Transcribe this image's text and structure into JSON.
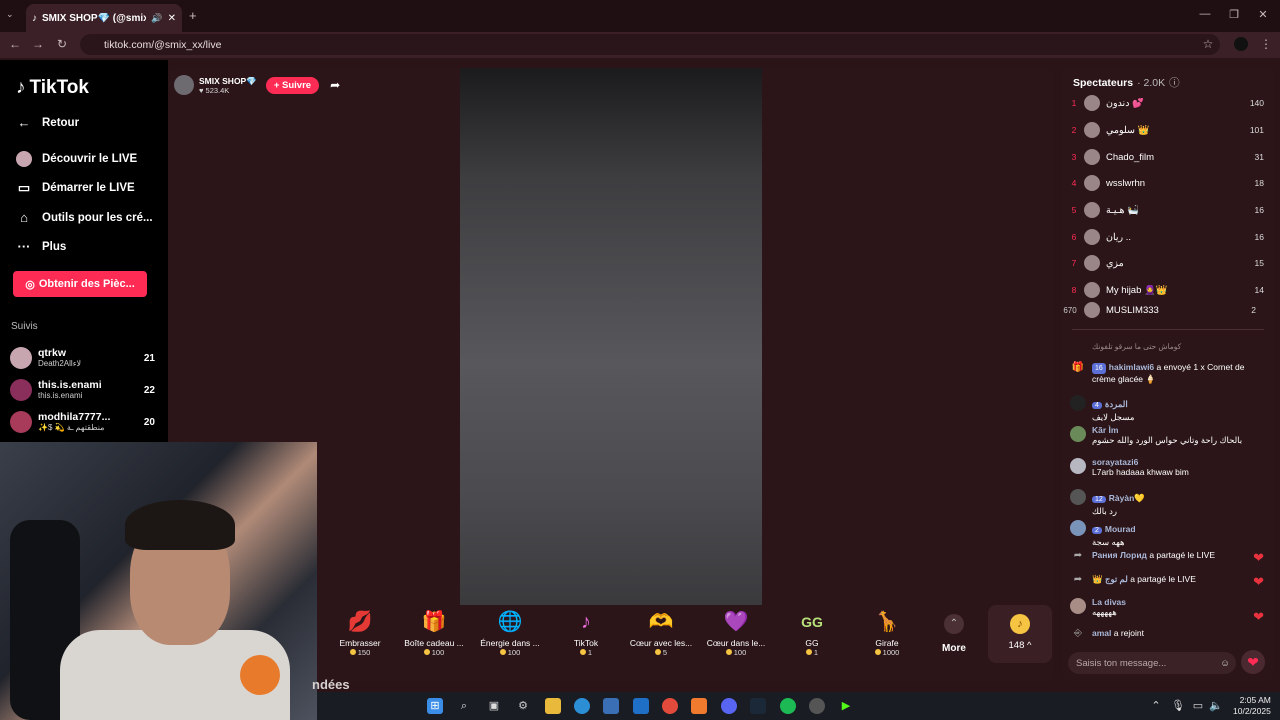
{
  "browser": {
    "tab_title": "SMIX SHOP💎 (@smix_xx) ...",
    "url": "tiktok.com/@smix_xx/live"
  },
  "sidebar": {
    "logo": "TikTok",
    "back": "Retour",
    "items": [
      {
        "label": "Découvrir le LIVE",
        "icon": "live-icon"
      },
      {
        "label": "Démarrer le LIVE",
        "icon": "camera-icon"
      },
      {
        "label": "Outils pour les cré...",
        "icon": "home-icon"
      },
      {
        "label": "Plus",
        "icon": "more-icon"
      }
    ],
    "coins_button": "Obtenir des Pièc...",
    "following_title": "Suivis",
    "following": [
      {
        "name": "qtrkw",
        "sub": "Death2Allلاء",
        "count": "21"
      },
      {
        "name": "this.is.enami",
        "sub": "this.is.enami",
        "count": "22"
      },
      {
        "name": "modhila7777...",
        "sub": "✨$ 💫 منطقتهم ـة",
        "count": "20"
      }
    ]
  },
  "stream": {
    "name": "SMIX SHOP💎",
    "likes": "♥ 523.4K",
    "follow": "+ Suivre"
  },
  "gifts": [
    {
      "name": "Embrasser",
      "price": "150",
      "icon": "💋"
    },
    {
      "name": "Boîte cadeau ...",
      "price": "100",
      "icon": "🎁"
    },
    {
      "name": "Énergie dans ...",
      "price": "100",
      "icon": "🌐"
    },
    {
      "name": "TikTok",
      "price": "1",
      "icon": "♪"
    },
    {
      "name": "Cœur avec les...",
      "price": "5",
      "icon": "🫶"
    },
    {
      "name": "Cœur dans le...",
      "price": "100",
      "icon": "💜"
    },
    {
      "name": "GG",
      "price": "1",
      "icon": "GG"
    },
    {
      "name": "Girafe",
      "price": "1000",
      "icon": "🦒"
    }
  ],
  "more_label": "More",
  "coin_balance": "148 ^",
  "webcam_text": "ndées",
  "viewers": {
    "title": "Spectateurs",
    "count": "· 2.0K",
    "ranks": [
      {
        "rank": "1",
        "name": "دندون 💕",
        "score": "140"
      },
      {
        "rank": "2",
        "name": "سلومي 👑",
        "score": "101"
      },
      {
        "rank": "3",
        "name": "Chado_film",
        "score": "31"
      },
      {
        "rank": "4",
        "name": "wsslwrhn",
        "score": "18"
      },
      {
        "rank": "5",
        "name": "هـيـة 🛀",
        "score": "16"
      },
      {
        "rank": "6",
        "name": "ريان ..",
        "score": "16"
      },
      {
        "rank": "7",
        "name": "مزي",
        "score": "15"
      },
      {
        "rank": "8",
        "name": "My hijab 🧕👑",
        "score": "14"
      },
      {
        "rank": "670",
        "name": "MUSLIM333",
        "score": "2"
      }
    ]
  },
  "chat": {
    "system_note": "كوماش حتى ما سرقو تلفونك",
    "messages": [
      {
        "type": "gift",
        "level": "16",
        "user": "hakimlawi6",
        "msg": "a envoyé 1 x Cornet de crème glacée 🍦"
      },
      {
        "type": "msg",
        "level": "4",
        "user": "المردة",
        "msg": "مسجل لايف"
      },
      {
        "type": "msg",
        "level": "",
        "user": "Kãr Ìm",
        "msg": "بالحاك راحة وتاني حواس الورد والله حشوم"
      },
      {
        "type": "msg",
        "level": "",
        "user": "sorayatazi6",
        "msg": "L7arb hadaaa khwaw bim"
      },
      {
        "type": "msg",
        "level": "12",
        "user": "Ràyàn💛",
        "msg": "رد بالك"
      },
      {
        "type": "msg",
        "level": "2",
        "user": "Mourad",
        "msg": "ههه سجة"
      },
      {
        "type": "share",
        "level": "",
        "user": "Рания Лорид",
        "msg": "a partagé le LIVE"
      },
      {
        "type": "share",
        "level": "",
        "user": "👑 لم توج",
        "msg": "a partagé le LIVE"
      },
      {
        "type": "msg",
        "level": "",
        "user": "La divas",
        "msg": "هههههه"
      },
      {
        "type": "join",
        "level": "",
        "user": "amal",
        "msg": "a rejoint"
      }
    ],
    "placeholder": "Saisis ton message..."
  },
  "clock": {
    "time": "2:05 AM",
    "date": "10/2/2025"
  }
}
